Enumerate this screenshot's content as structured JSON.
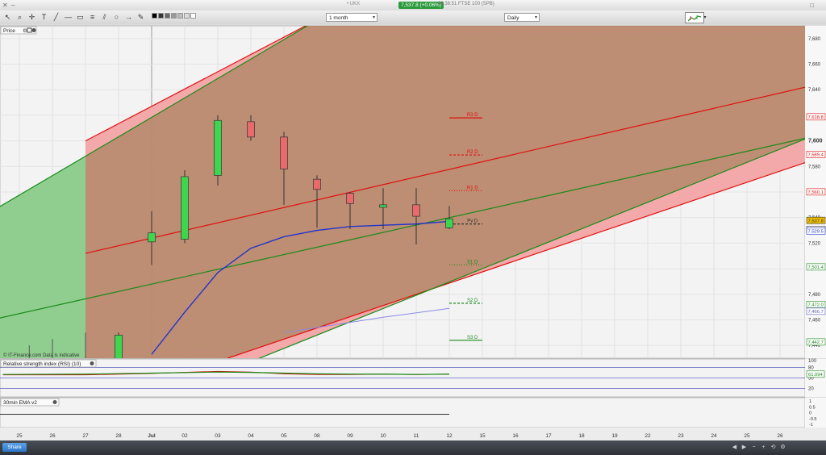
{
  "window": {
    "title": "• UKX",
    "price_badge": "7,537.8 (+0.06%)",
    "title_rest": "08:38:51 FTSE 100 (SPB)"
  },
  "toolbar": {
    "period_select": "1 month",
    "interval_select": "Daily",
    "tools": [
      "pointer-icon",
      "zoom-icon",
      "crosshair-icon",
      "text-icon",
      "trendline-icon",
      "horizontal-line-icon",
      "rectangle-icon",
      "arrow-icon",
      "channel-icon"
    ],
    "palette": [
      "#000000",
      "#333333",
      "#666666",
      "#999999",
      "#bbbbbb",
      "#dddddd",
      "#ffffff"
    ]
  },
  "panels": {
    "price_label": "Price",
    "rsi_label": "Relative strength index (RSI) (10)",
    "ema_label": "30min EMA v2",
    "watermark": "© IT-Finance.com  Data is indicative"
  },
  "taskbar": {
    "share_label": "Share"
  },
  "colors": {
    "bull": "#3fd64f",
    "bear": "#e86a6a",
    "channel_red": "#e01010",
    "channel_green": "#1a8a1a",
    "ema": "#2233cc",
    "brown_fill": "#b9886c",
    "pink_fill": "#f3a9a9",
    "green_fill": "#8fce8f",
    "rsi_purple": "#6060c0",
    "highlight_label": "#f0c000"
  },
  "chart_data": {
    "type": "candlestick",
    "x_axis_labels": [
      "25",
      "26",
      "27",
      "28",
      "Jul",
      "02",
      "03",
      "04",
      "05",
      "08",
      "09",
      "10",
      "11",
      "12",
      "15",
      "16",
      "17",
      "18",
      "19",
      "22",
      "23",
      "24",
      "25",
      "26"
    ],
    "y_axis": {
      "ylim": [
        7430,
        7690
      ],
      "ticks": [
        7440,
        7460,
        7480,
        7500,
        7520,
        7540,
        7560,
        7580,
        7600,
        7620,
        7640,
        7660,
        7680
      ],
      "tick_labels": [
        "7,440",
        "7,460",
        "7,480",
        "7,500",
        "7,520",
        "7,540",
        "7,560",
        "7,580",
        "7,600",
        "7,620",
        "7,640",
        "7,660",
        "7,680"
      ],
      "bold_tick": 7600
    },
    "candles": [
      {
        "x": 3,
        "open": 7405,
        "high": 7450,
        "low": 7380,
        "close": 7448
      },
      {
        "x": 4,
        "open": 7521,
        "high": 7545,
        "low": 7503,
        "close": 7528
      },
      {
        "x": 5,
        "open": 7523,
        "high": 7577,
        "low": 7520,
        "close": 7572
      },
      {
        "x": 6,
        "open": 7573,
        "high": 7620,
        "low": 7565,
        "close": 7616
      },
      {
        "x": 7,
        "open": 7615,
        "high": 7620,
        "low": 7600,
        "close": 7603
      },
      {
        "x": 8,
        "open": 7603,
        "high": 7607,
        "low": 7550,
        "close": 7578
      },
      {
        "x": 9,
        "open": 7570,
        "high": 7573,
        "low": 7532,
        "close": 7562
      },
      {
        "x": 10,
        "open": 7559,
        "high": 7560,
        "low": 7531,
        "close": 7551
      },
      {
        "x": 11,
        "open": 7548,
        "high": 7563,
        "low": 7531,
        "close": 7550
      },
      {
        "x": 12,
        "open": 7550,
        "high": 7563,
        "low": 7519,
        "close": 7541
      },
      {
        "x": 13,
        "open": 7532,
        "high": 7549,
        "low": 7531,
        "close": 7539
      }
    ],
    "ema_points": [
      [
        4.0,
        7433
      ],
      [
        5.0,
        7466
      ],
      [
        6.0,
        7497
      ],
      [
        7.0,
        7516
      ],
      [
        8.0,
        7525
      ],
      [
        9.0,
        7530
      ],
      [
        10.0,
        7533
      ],
      [
        11.0,
        7534
      ],
      [
        12.0,
        7535
      ],
      [
        13.0,
        7537
      ]
    ],
    "ema_projection": [
      [
        8.0,
        7450
      ],
      [
        11.0,
        7462
      ],
      [
        13.0,
        7469
      ]
    ],
    "pivots": [
      {
        "label": "R3 D",
        "value": 7618,
        "color": "#e01010",
        "style": "solid"
      },
      {
        "label": "R2 D",
        "value": 7589,
        "color": "#e01010",
        "style": "dashed"
      },
      {
        "label": "R1 D",
        "value": 7561,
        "color": "#e01010",
        "style": "dotted"
      },
      {
        "label": "Pv D",
        "value": 7535,
        "color": "#333333",
        "style": "dashed"
      },
      {
        "label": "S1 D",
        "value": 7503,
        "color": "#1a8a1a",
        "style": "dotted"
      },
      {
        "label": "S2 D",
        "value": 7473,
        "color": "#1a8a1a",
        "style": "dashed"
      },
      {
        "label": "S3 D",
        "value": 7444,
        "color": "#1a8a1a",
        "style": "solid"
      }
    ],
    "price_labels": [
      {
        "text": "7,618.8",
        "value": 7618.8,
        "color": "#e01010"
      },
      {
        "text": "7,589.4",
        "value": 7589.4,
        "color": "#e01010"
      },
      {
        "text": "7,560.1",
        "value": 7560.1,
        "color": "#e01010"
      },
      {
        "text": "7,537.8",
        "value": 7537.8,
        "color": "#333333",
        "highlight": true
      },
      {
        "text": "7,530.7",
        "value": 7530.7,
        "color": "#333333"
      },
      {
        "text": "7,529.5",
        "value": 7529.5,
        "color": "#2233cc"
      },
      {
        "text": "7,501.4",
        "value": 7501.4,
        "color": "#1a8a1a"
      },
      {
        "text": "7,472.0",
        "value": 7472.0,
        "color": "#1a8a1a"
      },
      {
        "text": "7,466.7",
        "value": 7466.7,
        "color": "#6060c0"
      },
      {
        "text": "7,442.7",
        "value": 7442.7,
        "color": "#1a8a1a"
      }
    ],
    "channels": {
      "red_upper": [
        [
          2.0,
          7600
        ],
        [
          12.5,
          7742
        ]
      ],
      "red_lower": [
        [
          2.0,
          7512
        ],
        [
          24.1,
          7644
        ]
      ],
      "red_lower2": [
        [
          6.3,
          7430
        ],
        [
          24.1,
          7586
        ]
      ],
      "green_upper": [
        [
          -0.5,
          7550
        ],
        [
          12.0,
          7740
        ]
      ],
      "green_mid": [
        [
          -0.5,
          7462
        ],
        [
          24.1,
          7604
        ]
      ],
      "green_lower": [
        [
          6.3,
          7420
        ],
        [
          24.1,
          7605
        ]
      ]
    },
    "rsi": {
      "label": "Relative strength index (RSI) (10)",
      "ylim": [
        0,
        100
      ],
      "ticks": [
        0,
        20,
        50,
        80,
        100
      ],
      "tick_labels": [
        "",
        "20",
        "50",
        "80",
        "100"
      ],
      "value_label": "61.094",
      "values": [
        [
          -0.5,
          60
        ],
        [
          2.0,
          61
        ],
        [
          4.0,
          64
        ],
        [
          6.0,
          67
        ],
        [
          7.0,
          66
        ],
        [
          8.0,
          64
        ],
        [
          9.0,
          62
        ],
        [
          10.0,
          61
        ],
        [
          11.0,
          61
        ],
        [
          12.0,
          60
        ],
        [
          13.0,
          61
        ]
      ],
      "signal": [
        [
          -0.5,
          59
        ],
        [
          2.0,
          59
        ],
        [
          4.0,
          63
        ],
        [
          6.0,
          69
        ],
        [
          7.0,
          67
        ],
        [
          8.0,
          62
        ],
        [
          9.0,
          60
        ],
        [
          10.0,
          60
        ],
        [
          11.0,
          61
        ],
        [
          12.0,
          60
        ],
        [
          13.0,
          61
        ]
      ],
      "lines": [
        80,
        50,
        20
      ]
    },
    "ema_panel": {
      "label": "30min EMA v2",
      "ticks": [
        1,
        0.5,
        0,
        -0.5,
        -1
      ],
      "tick_labels": [
        "1",
        "0.5",
        "0",
        "-0.5",
        "-1"
      ]
    }
  }
}
